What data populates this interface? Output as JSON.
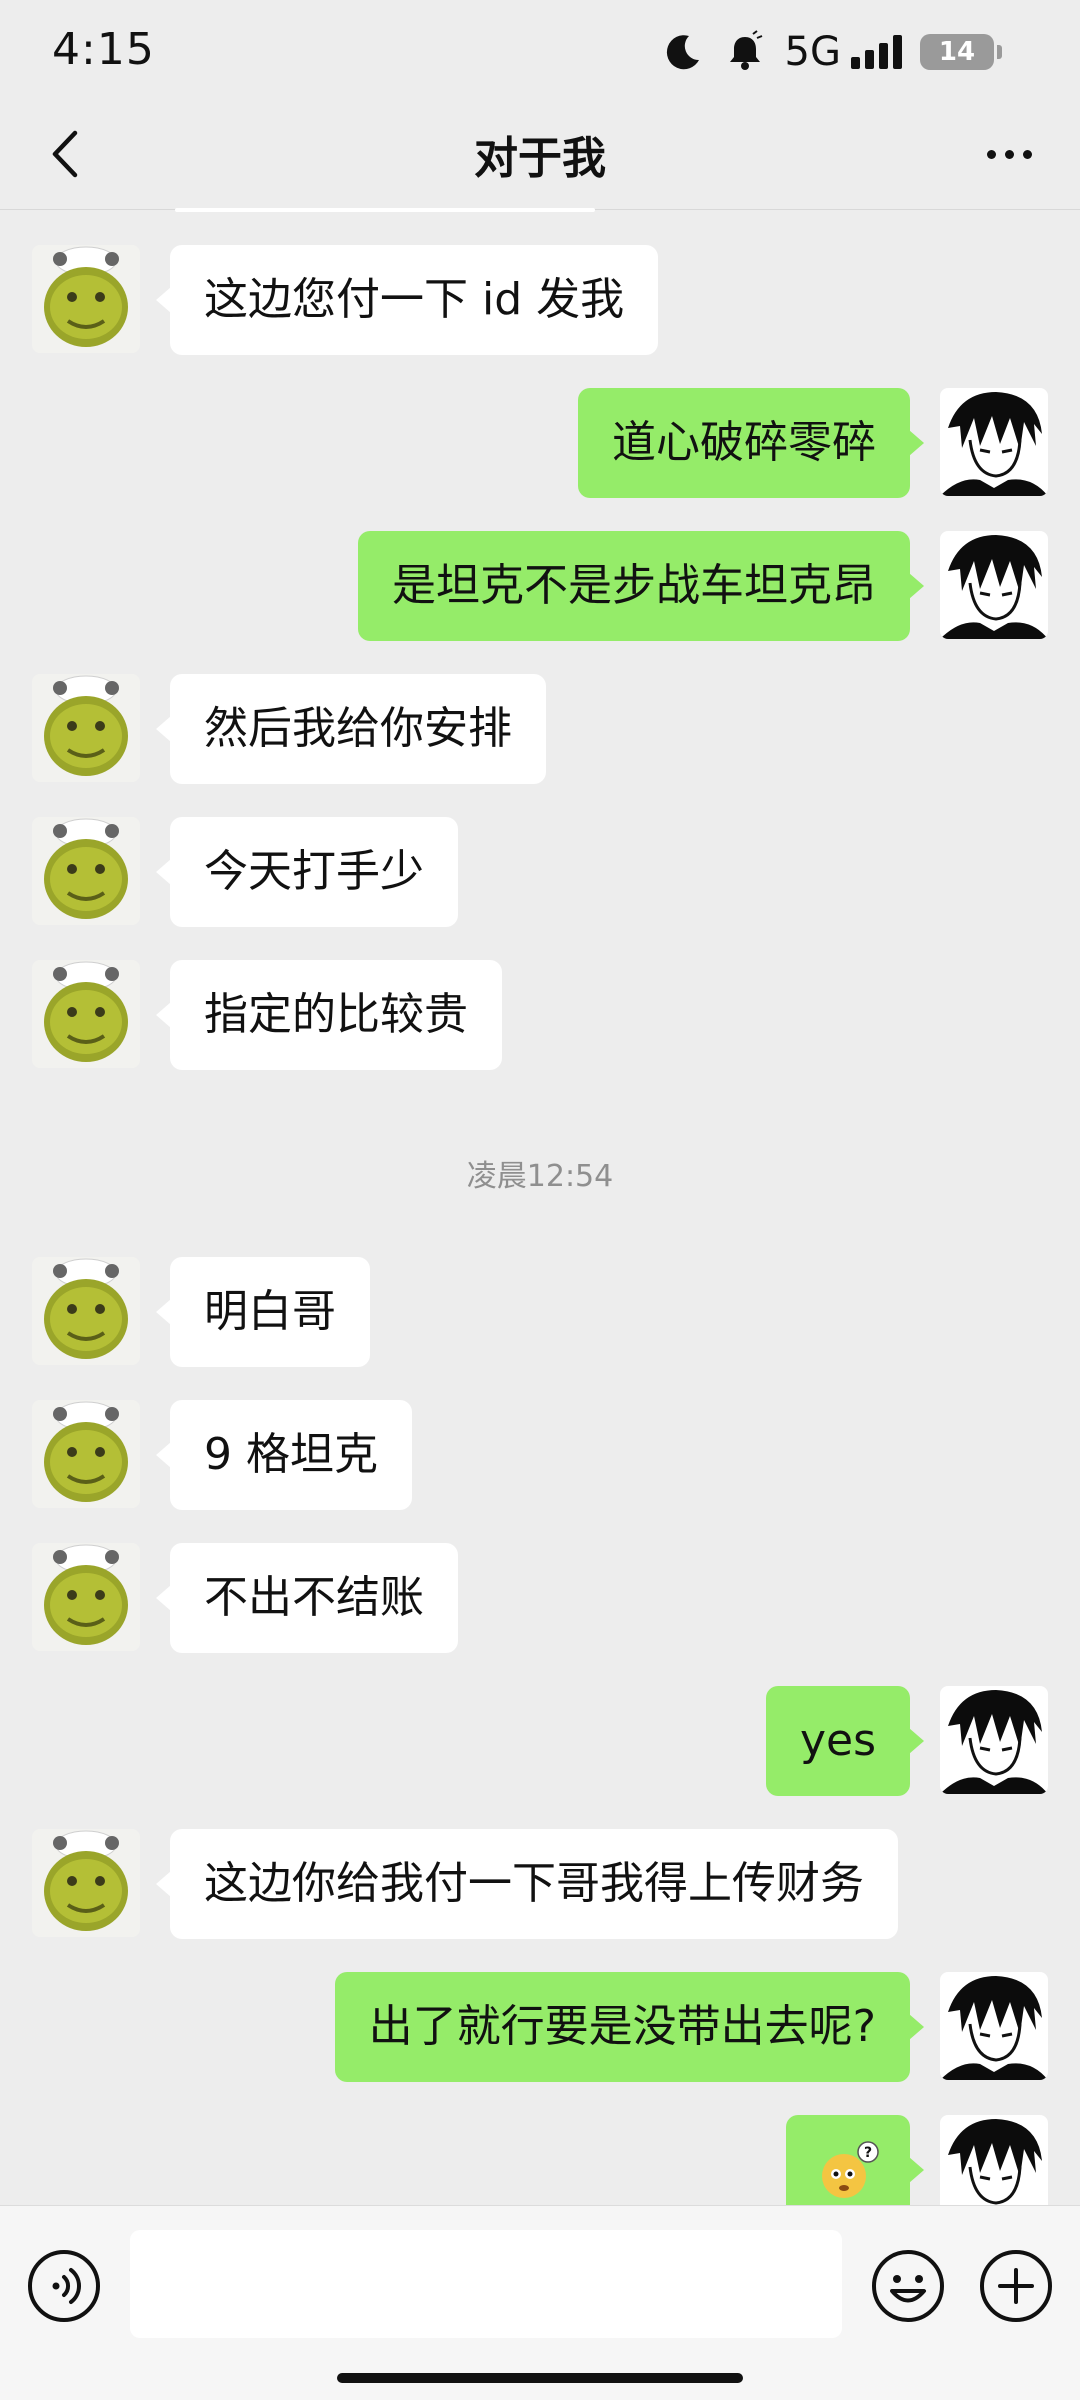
{
  "status_bar": {
    "time": "4:15",
    "network": "5G",
    "battery": "14",
    "icons": [
      "moon-icon",
      "bell-icon",
      "signal-icon",
      "battery-icon"
    ]
  },
  "nav": {
    "title": "对于我",
    "back_icon": "chevron-left-icon",
    "more_icon": "more-dots-icon"
  },
  "colors": {
    "background": "#ededed",
    "bubble_in": "#ffffff",
    "bubble_out": "#95ec69",
    "timestamp": "#8f8f8f"
  },
  "messages": [
    {
      "side": "in",
      "text": "这边您付一下 id 发我"
    },
    {
      "side": "out",
      "text": "道心破碎零碎"
    },
    {
      "side": "out",
      "text": "是坦克不是步战车坦克昂"
    },
    {
      "side": "in",
      "text": "然后我给你安排"
    },
    {
      "side": "in",
      "text": "今天打手少"
    },
    {
      "side": "in",
      "text": "指定的比较贵"
    },
    {
      "side": "in",
      "text": "明白哥"
    },
    {
      "side": "in",
      "text": "9 格坦克"
    },
    {
      "side": "in",
      "text": "不出不结账"
    },
    {
      "side": "out",
      "text": "yes"
    },
    {
      "side": "in",
      "text": "这边你给我付一下哥我得上传财务"
    },
    {
      "side": "out",
      "text": "出了就行要是没带出去呢?"
    },
    {
      "side": "out",
      "emoji": "confused-emoji-icon"
    }
  ],
  "timestamp": "凌晨12:54",
  "input_bar": {
    "placeholder": "",
    "icons": [
      "voice-icon",
      "emoji-icon",
      "plus-icon"
    ]
  }
}
